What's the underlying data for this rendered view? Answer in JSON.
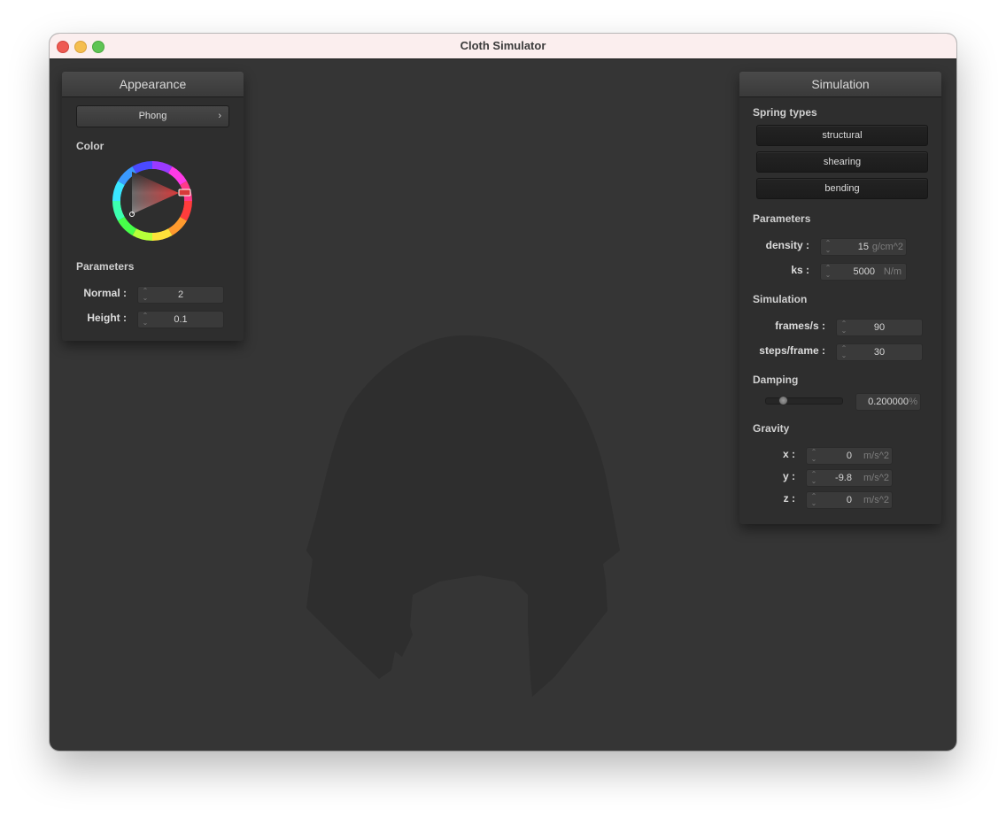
{
  "window": {
    "title": "Cloth Simulator",
    "controls": [
      "close",
      "minimize",
      "zoom"
    ]
  },
  "appearance": {
    "header": "Appearance",
    "shader": "Phong",
    "color_label": "Color",
    "color_hex": "#d83a3a",
    "parameters_label": "Parameters",
    "normal_label": "Normal :",
    "normal_value": "2",
    "height_label": "Height :",
    "height_value": "0.1"
  },
  "simulation": {
    "header": "Simulation",
    "spring_types_label": "Spring types",
    "spring_types": [
      "structural",
      "shearing",
      "bending"
    ],
    "parameters_label": "Parameters",
    "density_label": "density :",
    "density_value": "15",
    "density_unit": "g/cm^2",
    "ks_label": "ks :",
    "ks_value": "5000",
    "ks_unit": "N/m",
    "simulation_label": "Simulation",
    "fps_label": "frames/s :",
    "fps_value": "90",
    "steps_label": "steps/frame :",
    "steps_value": "30",
    "damping_label": "Damping",
    "damping_value": "0.200000",
    "damping_unit": "%",
    "damping_fraction": 0.2,
    "gravity_label": "Gravity",
    "gx_label": "x :",
    "gx_value": "0",
    "gy_label": "y :",
    "gy_value": "-9.8",
    "gz_label": "z :",
    "gz_value": "0",
    "gravity_unit": "m/s^2"
  },
  "colors": {
    "background": "#353535",
    "cloth": "#2e2e2e",
    "panel": "#2e2e2e",
    "selected_color": "#d83a3a"
  }
}
